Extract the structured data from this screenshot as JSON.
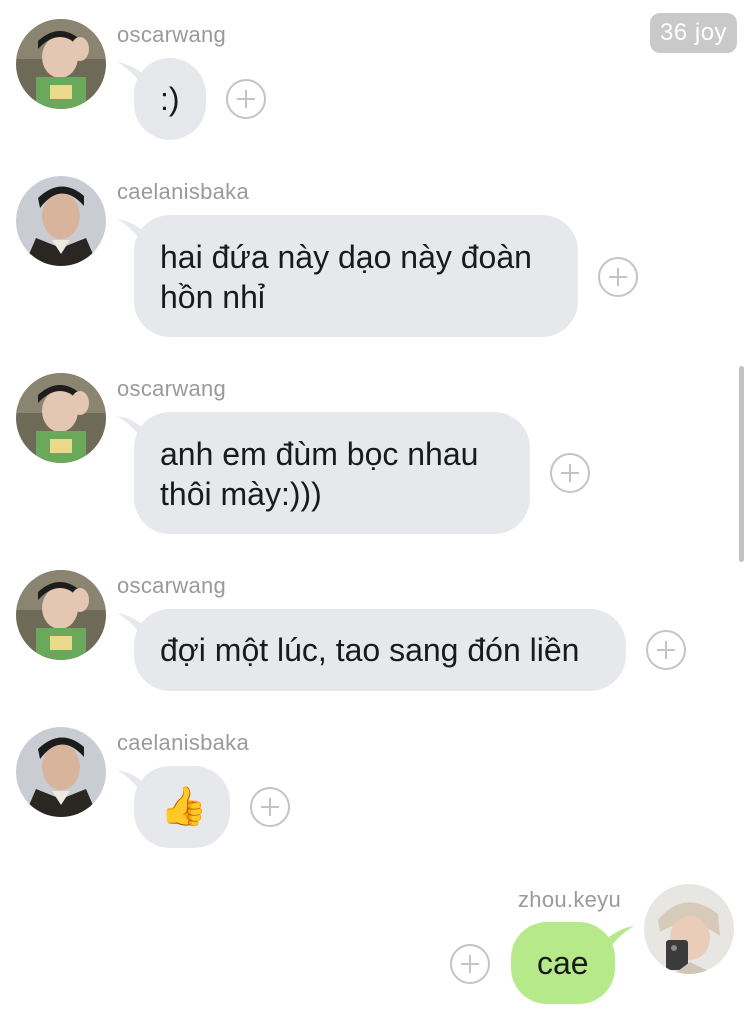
{
  "badge": "36 joy",
  "messages": [
    {
      "user": "oscarwang",
      "text": ":)"
    },
    {
      "user": "caelanisbaka",
      "line1": "hai đứa này dạo này đoàn",
      "line2": "hồn nhỉ"
    },
    {
      "user": "oscarwang",
      "line1": "anh em đùm bọc nhau",
      "line2": "thôi mày:)))"
    },
    {
      "user": "oscarwang",
      "text": "đợi một lúc, tao sang đón liền"
    },
    {
      "user": "caelanisbaka",
      "emoji": "👍"
    },
    {
      "user": "zhou.keyu",
      "text": "cae"
    }
  ],
  "colors": {
    "incoming_bubble": "#e6e8ec",
    "outgoing_bubble": "#b6e98a",
    "username": "#9a9a9a",
    "badge": "#c9c9c9"
  },
  "icons": [
    "add-reaction-icon",
    "thumbs-up-icon"
  ]
}
